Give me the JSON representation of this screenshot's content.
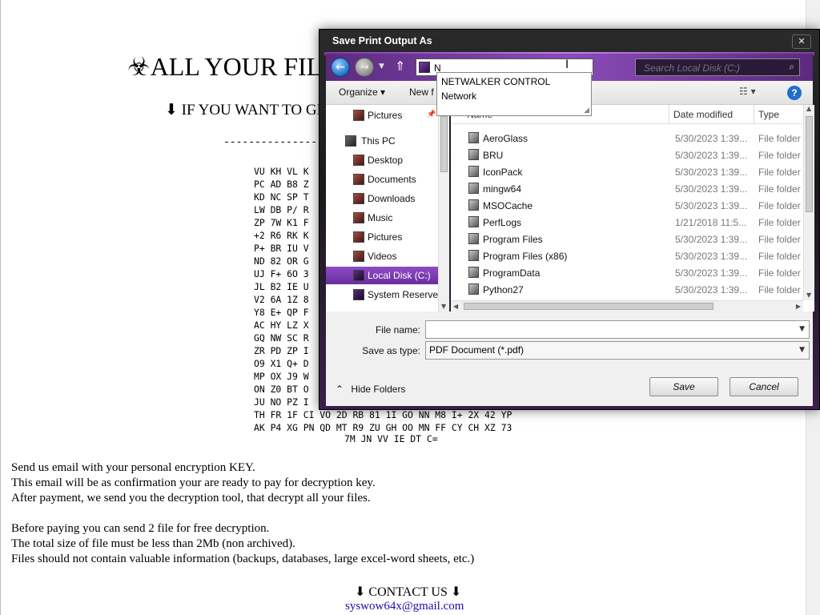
{
  "note": {
    "title": "☣ALL YOUR FIL",
    "subtitle": "⬇ IF YOU WANT TO GE",
    "dashes": "------------------------------",
    "key_lines": [
      "VU KH VL K",
      "PC AD B8 Z",
      "KD NC SP T",
      "LW DB P/ R",
      "ZP 7W K1 F",
      "+2 R6 RK K",
      "P+ BR IU V",
      "ND 82 OR G",
      "UJ F+ 6O 3",
      "JL B2 IE U",
      "V2 6A 1Z 8",
      "Y8 E+ QP F",
      "AC HY LZ X",
      "GQ NW SC R",
      "ZR PD ZP I",
      "O9 X1 Q+ D",
      "MP OX J9 W",
      "ON Z0 BT O",
      "JU NO PZ I",
      "TH FR 1F CI VO 2D RB 81 1I GO NN M8 I+ 2X 42 YP",
      "AK P4 XG PN QD MT R9 ZU GH OO MN FF CY CH XZ 73"
    ],
    "key_tail": "7M JN VV IE DT C=",
    "paragraph1": [
      "Send us email with your personal encryption KEY.",
      "This email will be as confirmation your are ready to pay for decryption key.",
      "After payment, we send you the decryption tool, that decrypt all your files."
    ],
    "paragraph2": [
      "Before paying you can send 2 file for free decryption.",
      "The total size of file must be less than 2Mb (non archived).",
      "Files should not contain valuable information (backups, databases, large excel-word sheets, etc.)"
    ],
    "contact_heading": "⬇ CONTACT US ⬇",
    "contact_email": "syswow64x@gmail.com"
  },
  "dialog": {
    "title": "Save Print Output As",
    "close_glyph": "✕",
    "address": {
      "back_glyph": "←",
      "forward_glyph": "→",
      "history_glyph": "▼",
      "up_glyph": "⇑",
      "path_value": "N",
      "cursor_glyph": "Ι",
      "search_placeholder": "Search Local Disk (C:)",
      "search_icon": "search-icon"
    },
    "autocomplete": [
      "NETWALKER CONTROL",
      "Network"
    ],
    "toolbar": {
      "organize": "Organize ▾",
      "new_folder": "New f",
      "view_glyph": "☷ ▾",
      "help_glyph": "?"
    },
    "nav": [
      {
        "label": "Pictures",
        "indent": 1,
        "pin": "📌"
      },
      {
        "label": "This PC",
        "indent": 0
      },
      {
        "label": "Desktop",
        "indent": 1
      },
      {
        "label": "Documents",
        "indent": 1
      },
      {
        "label": "Downloads",
        "indent": 1
      },
      {
        "label": "Music",
        "indent": 1
      },
      {
        "label": "Pictures",
        "indent": 1
      },
      {
        "label": "Videos",
        "indent": 1
      },
      {
        "label": "Local Disk (C:)",
        "indent": 1,
        "selected": true
      },
      {
        "label": "System Reserved",
        "indent": 1
      }
    ],
    "columns": {
      "name": "Name",
      "date": "Date modified",
      "type": "Type"
    },
    "files": [
      {
        "name": "AeroGlass",
        "date": "5/30/2023 1:39...",
        "type": "File folder"
      },
      {
        "name": "BRU",
        "date": "5/30/2023 1:39...",
        "type": "File folder"
      },
      {
        "name": "IconPack",
        "date": "5/30/2023 1:39...",
        "type": "File folder"
      },
      {
        "name": "mingw64",
        "date": "5/30/2023 1:39...",
        "type": "File folder"
      },
      {
        "name": "MSOCache",
        "date": "5/30/2023 1:39...",
        "type": "File folder"
      },
      {
        "name": "PerfLogs",
        "date": "1/21/2018 11:5...",
        "type": "File folder"
      },
      {
        "name": "Program Files",
        "date": "5/30/2023 1:39...",
        "type": "File folder"
      },
      {
        "name": "Program Files (x86)",
        "date": "5/30/2023 1:39...",
        "type": "File folder"
      },
      {
        "name": "ProgramData",
        "date": "5/30/2023 1:39...",
        "type": "File folder"
      },
      {
        "name": "Python27",
        "date": "5/30/2023 1:39...",
        "type": "File folder"
      }
    ],
    "file_name_label": "File name:",
    "file_name_value": "",
    "save_as_type_label": "Save as type:",
    "save_as_type_value": "PDF Document (*.pdf)",
    "hide_folders": "Hide Folders",
    "hide_folders_glyph": "⌃",
    "save_button": "Save",
    "cancel_button": "Cancel"
  }
}
